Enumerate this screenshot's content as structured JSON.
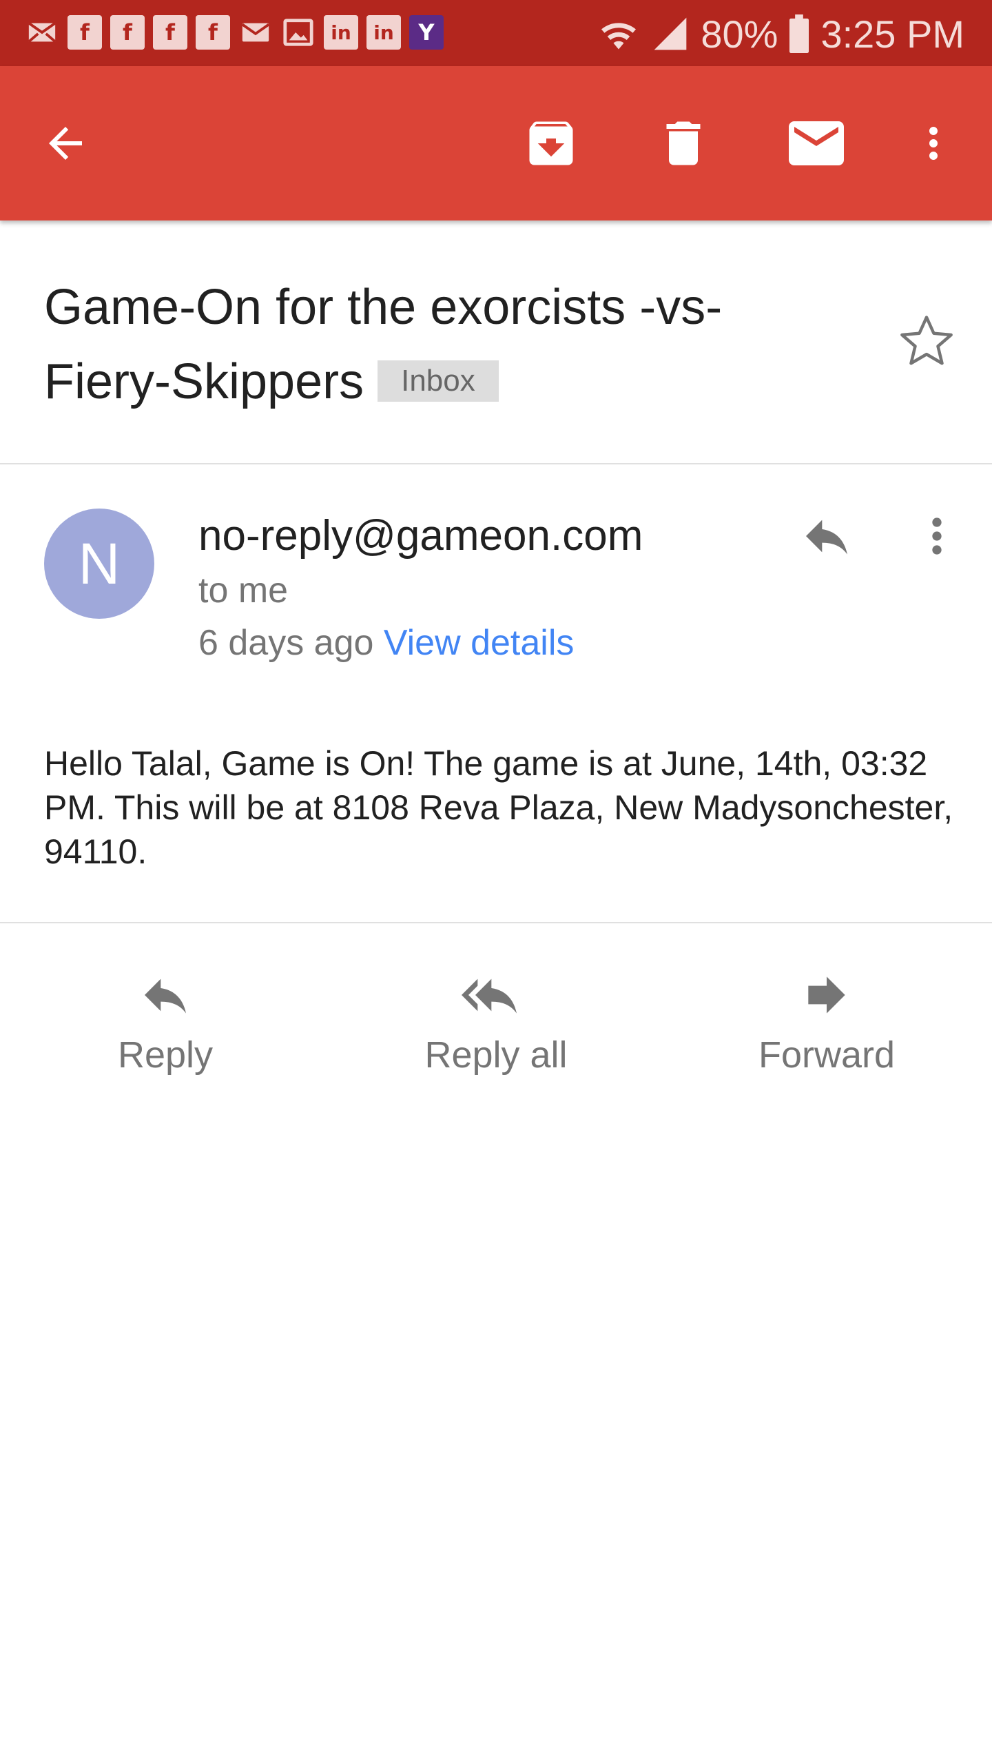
{
  "status_bar": {
    "notification_icons": [
      "gmail-icon",
      "facebook-icon",
      "facebook-icon",
      "facebook-icon",
      "facebook-icon",
      "email-icon",
      "photo-icon",
      "linkedin-icon",
      "linkedin-icon",
      "yahoo-icon"
    ],
    "facebook_glyph": "f",
    "linkedin_glyph": "in",
    "yahoo_glyph": "Y",
    "battery": "80%",
    "time": "3:25 PM"
  },
  "app_bar": {
    "color": "#db4437",
    "actions": [
      "back-arrow-icon",
      "archive-icon",
      "delete-icon",
      "mark-unread-icon",
      "more-vert-icon"
    ]
  },
  "email": {
    "subject": "Game-On for the exorcists -vs- Fiery-Skippers",
    "label": "Inbox",
    "starred": false,
    "sender": {
      "avatar_letter": "N",
      "avatar_color": "#9fa8da",
      "address": "no-reply@gameon.com",
      "recipient_line": "to me",
      "time_ago": "6 days ago",
      "details_link": "View details"
    },
    "body": "Hello Talal, Game is On! The game is at June, 14th, 03:32 PM. This will be at 8108 Reva Plaza, New Madysonchester, 94110."
  },
  "actions": {
    "reply": "Reply",
    "reply_all": "Reply all",
    "forward": "Forward"
  },
  "colors": {
    "link": "#4285f4",
    "status_bar": "#b3261e"
  }
}
